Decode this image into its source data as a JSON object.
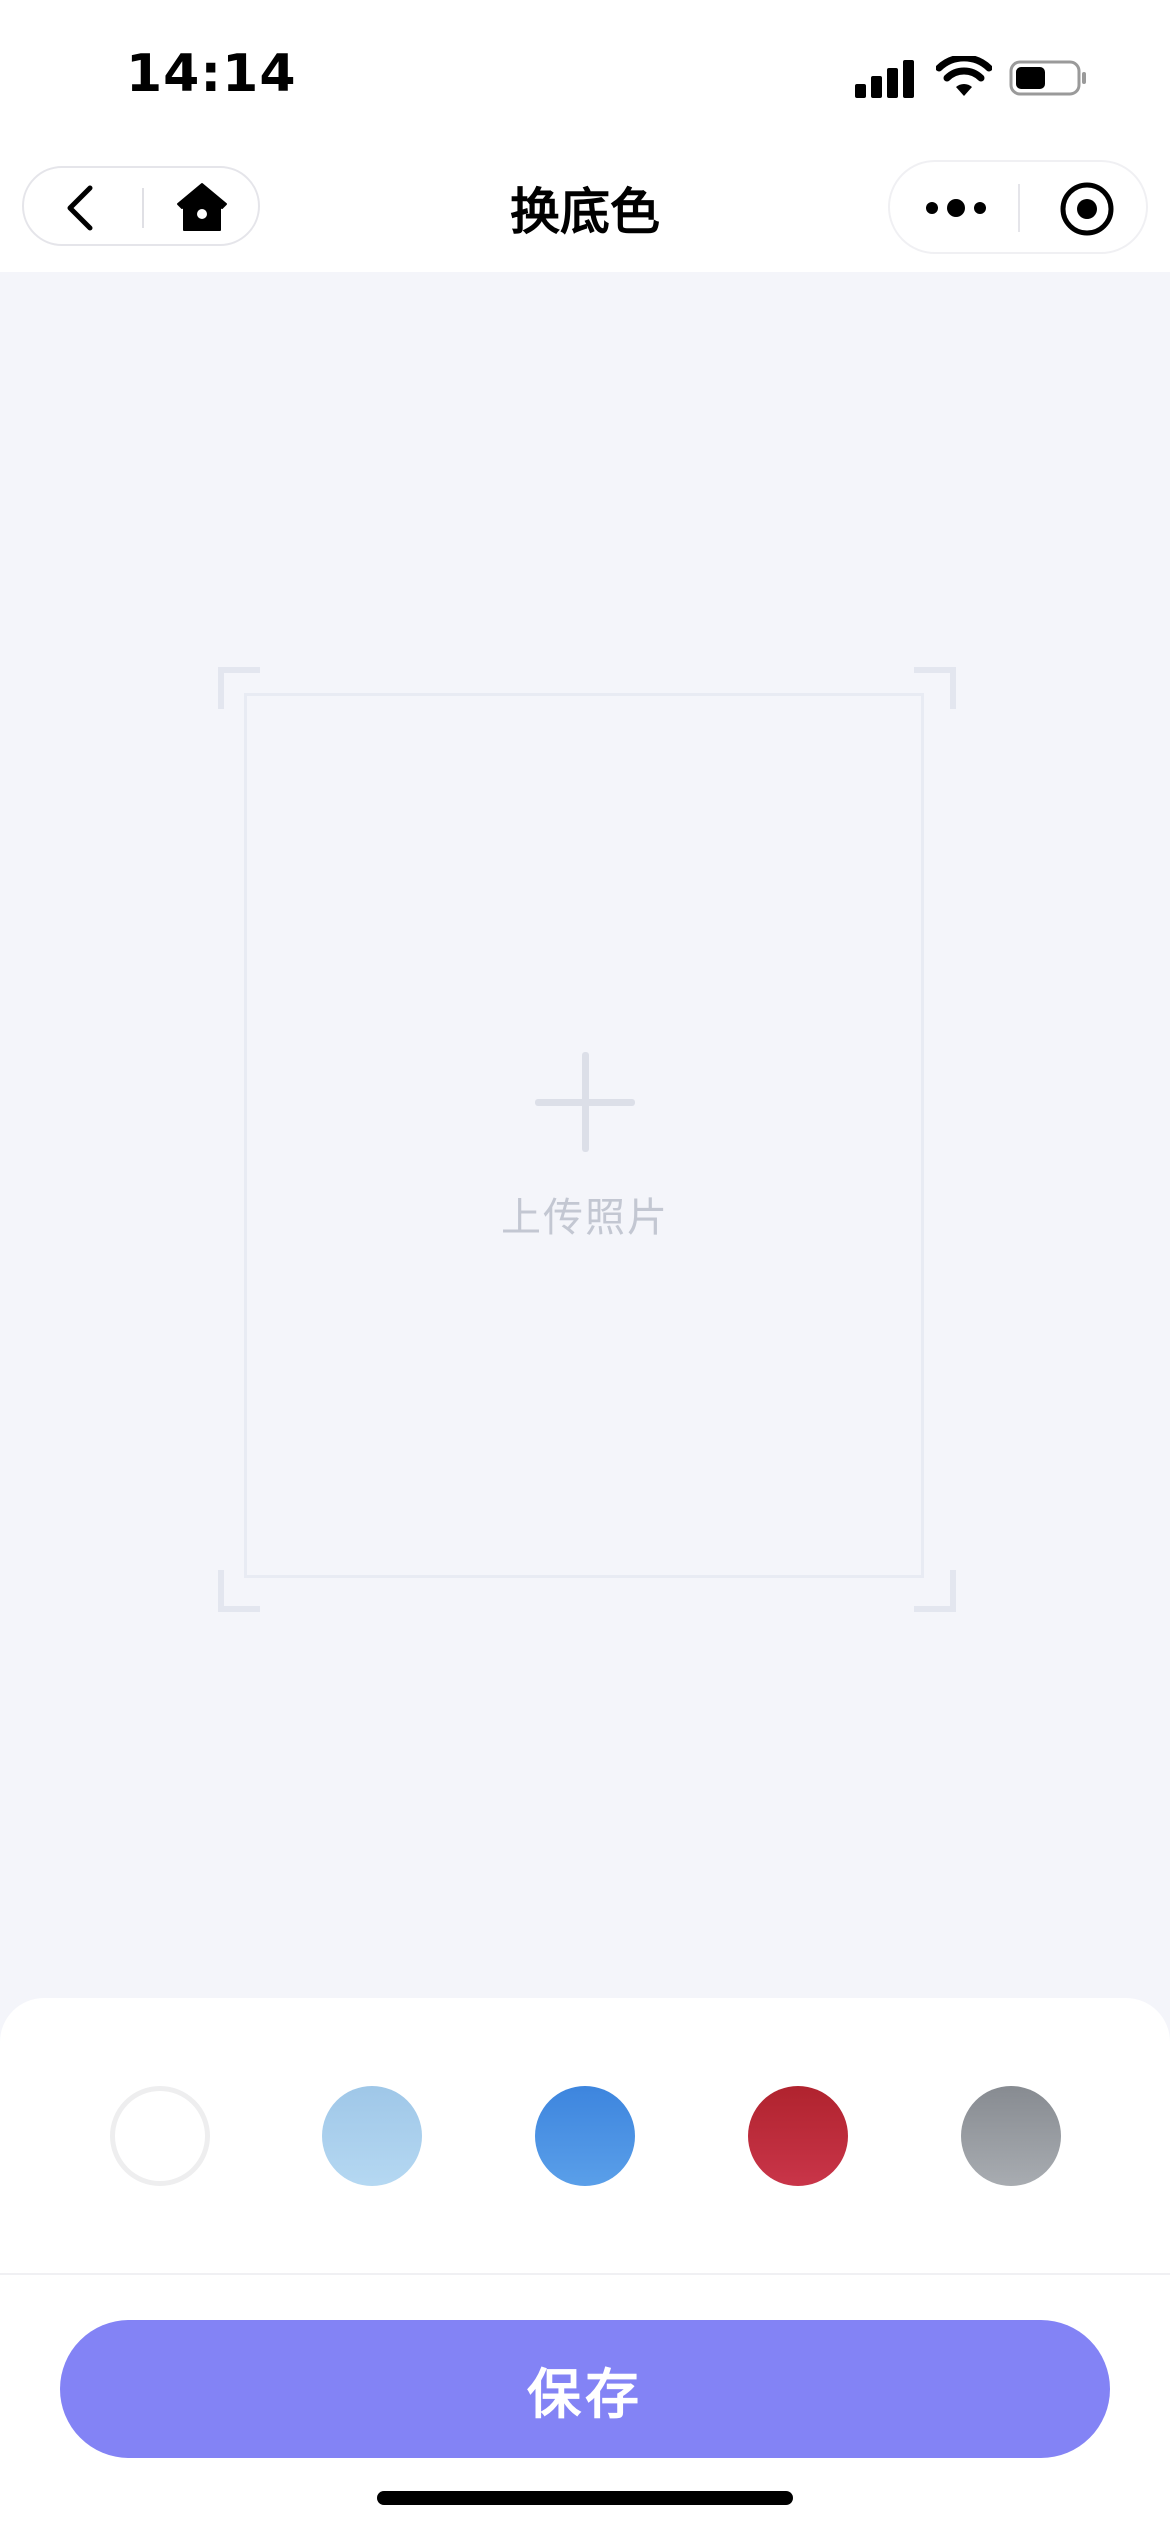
{
  "status_bar": {
    "time": "14:14",
    "signal_icon": "cellular-signal-icon",
    "wifi_icon": "wifi-icon",
    "battery_icon": "battery-icon",
    "battery_level": 0.5
  },
  "nav": {
    "title": "换底色",
    "back_icon": "chevron-left-icon",
    "home_icon": "home-icon",
    "more_icon": "more-dots-icon",
    "close_icon": "target-circle-icon"
  },
  "upload": {
    "label": "上传照片",
    "icon": "plus-icon"
  },
  "swatches": [
    {
      "name": "white",
      "colors": [
        "#ffffff",
        "#ffffff"
      ],
      "border": "#eeeeef"
    },
    {
      "name": "light-blue",
      "colors": [
        "#9fc7e8",
        "#b5d8f2"
      ],
      "border": "none"
    },
    {
      "name": "blue",
      "colors": [
        "#3d85de",
        "#5a9fe9"
      ],
      "border": "none"
    },
    {
      "name": "red",
      "colors": [
        "#b0232e",
        "#c93549"
      ],
      "border": "none"
    },
    {
      "name": "gray",
      "colors": [
        "#878b91",
        "#a8acb1"
      ],
      "border": "none"
    }
  ],
  "save_button": {
    "label": "保存"
  },
  "theme": {
    "accent": "#8383f5",
    "background": "#f4f5fa"
  }
}
